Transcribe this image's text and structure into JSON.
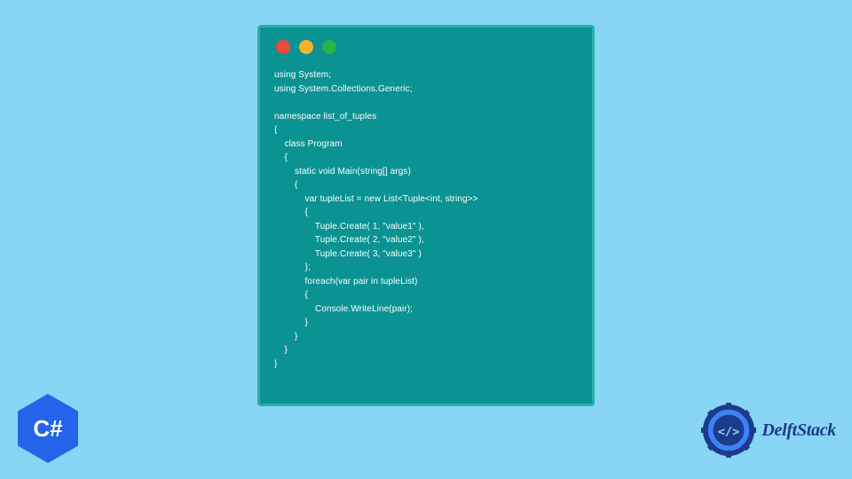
{
  "code": {
    "line1": "using System;",
    "line2": "using System.Collections.Generic;",
    "line3": "",
    "line4": "namespace list_of_tuples",
    "line5": "{",
    "line6": "    class Program",
    "line7": "    {",
    "line8": "        static void Main(string[] args)",
    "line9": "        {",
    "line10": "            var tupleList = new List<Tuple<int, string>>",
    "line11": "            {",
    "line12": "                Tuple.Create( 1, \"value1\" ),",
    "line13": "                Tuple.Create( 2, \"value2\" ),",
    "line14": "                Tuple.Create( 3, \"value3\" )",
    "line15": "            };",
    "line16": "            foreach(var pair in tupleList)",
    "line17": "            {",
    "line18": "                Console.WriteLine(pair);",
    "line19": "            }",
    "line20": "        }",
    "line21": "    }",
    "line22": "}"
  },
  "badge": {
    "csharp": "C#"
  },
  "brand": {
    "name": "DelftStack"
  }
}
